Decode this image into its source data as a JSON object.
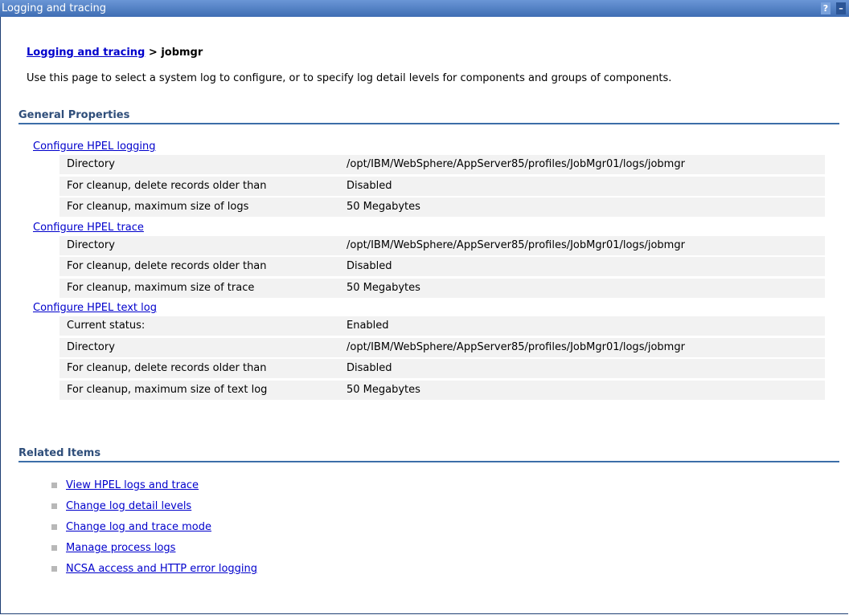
{
  "window": {
    "title": "Logging and tracing",
    "help_label": "?",
    "minimize_label": "–"
  },
  "breadcrumb": {
    "link": "Logging and tracing",
    "separator": " > ",
    "current": "jobmgr"
  },
  "description": "Use this page to select a system log to configure, or to specify log detail levels for components and groups of components.",
  "general_properties": {
    "header": "General Properties",
    "groups": [
      {
        "link": "Configure HPEL logging",
        "rows": [
          {
            "label": "Directory",
            "value": "/opt/IBM/WebSphere/AppServer85/profiles/JobMgr01/logs/jobmgr"
          },
          {
            "label": "For cleanup, delete records older than",
            "value": "Disabled"
          },
          {
            "label": "For cleanup, maximum size of logs",
            "value": "50 Megabytes"
          }
        ]
      },
      {
        "link": "Configure HPEL trace",
        "rows": [
          {
            "label": "Directory",
            "value": "/opt/IBM/WebSphere/AppServer85/profiles/JobMgr01/logs/jobmgr"
          },
          {
            "label": "For cleanup, delete records older than",
            "value": "Disabled"
          },
          {
            "label": "For cleanup, maximum size of trace",
            "value": "50 Megabytes"
          }
        ]
      },
      {
        "link": "Configure HPEL text log",
        "rows": [
          {
            "label": "Current status:",
            "value": "Enabled"
          },
          {
            "label": "Directory",
            "value": "/opt/IBM/WebSphere/AppServer85/profiles/JobMgr01/logs/jobmgr"
          },
          {
            "label": "For cleanup, delete records older than",
            "value": "Disabled"
          },
          {
            "label": "For cleanup, maximum size of text log",
            "value": "50 Megabytes"
          }
        ]
      }
    ]
  },
  "related_items": {
    "header": "Related Items",
    "links": [
      "View HPEL logs and trace",
      "Change log detail levels",
      "Change log and trace mode",
      "Manage process logs",
      "NCSA access and HTTP error logging"
    ]
  },
  "colors": {
    "titlebar": "#4d7fc4",
    "link": "#0000cc",
    "section_rule": "#3c6ea8",
    "row_bg": "#f2f2f2"
  }
}
